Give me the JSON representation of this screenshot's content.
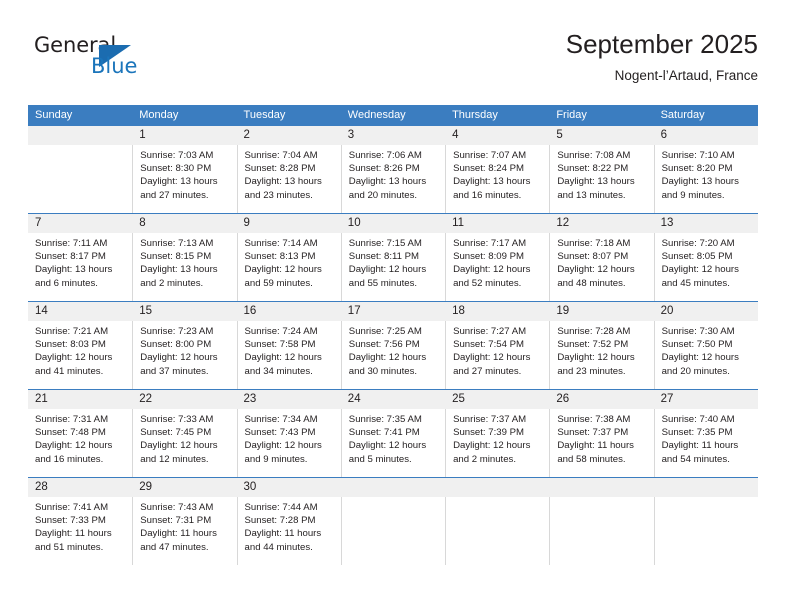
{
  "brand": {
    "name_part1": "General",
    "name_part2": "Blue",
    "accent_color": "#1b75bb"
  },
  "header": {
    "title": "September 2025",
    "subtitle": "Nogent-l’Artaud, France"
  },
  "calendar": {
    "header_color": "#3b7dc0",
    "day_band_color": "#f0f0f0",
    "weekday_headers": [
      "Sunday",
      "Monday",
      "Tuesday",
      "Wednesday",
      "Thursday",
      "Friday",
      "Saturday"
    ],
    "weeks": [
      {
        "days": [
          {
            "num": "",
            "sunrise": "",
            "sunset": "",
            "daylight1": "",
            "daylight2": ""
          },
          {
            "num": "1",
            "sunrise": "Sunrise: 7:03 AM",
            "sunset": "Sunset: 8:30 PM",
            "daylight1": "Daylight: 13 hours",
            "daylight2": "and 27 minutes."
          },
          {
            "num": "2",
            "sunrise": "Sunrise: 7:04 AM",
            "sunset": "Sunset: 8:28 PM",
            "daylight1": "Daylight: 13 hours",
            "daylight2": "and 23 minutes."
          },
          {
            "num": "3",
            "sunrise": "Sunrise: 7:06 AM",
            "sunset": "Sunset: 8:26 PM",
            "daylight1": "Daylight: 13 hours",
            "daylight2": "and 20 minutes."
          },
          {
            "num": "4",
            "sunrise": "Sunrise: 7:07 AM",
            "sunset": "Sunset: 8:24 PM",
            "daylight1": "Daylight: 13 hours",
            "daylight2": "and 16 minutes."
          },
          {
            "num": "5",
            "sunrise": "Sunrise: 7:08 AM",
            "sunset": "Sunset: 8:22 PM",
            "daylight1": "Daylight: 13 hours",
            "daylight2": "and 13 minutes."
          },
          {
            "num": "6",
            "sunrise": "Sunrise: 7:10 AM",
            "sunset": "Sunset: 8:20 PM",
            "daylight1": "Daylight: 13 hours",
            "daylight2": "and 9 minutes."
          }
        ]
      },
      {
        "days": [
          {
            "num": "7",
            "sunrise": "Sunrise: 7:11 AM",
            "sunset": "Sunset: 8:17 PM",
            "daylight1": "Daylight: 13 hours",
            "daylight2": "and 6 minutes."
          },
          {
            "num": "8",
            "sunrise": "Sunrise: 7:13 AM",
            "sunset": "Sunset: 8:15 PM",
            "daylight1": "Daylight: 13 hours",
            "daylight2": "and 2 minutes."
          },
          {
            "num": "9",
            "sunrise": "Sunrise: 7:14 AM",
            "sunset": "Sunset: 8:13 PM",
            "daylight1": "Daylight: 12 hours",
            "daylight2": "and 59 minutes."
          },
          {
            "num": "10",
            "sunrise": "Sunrise: 7:15 AM",
            "sunset": "Sunset: 8:11 PM",
            "daylight1": "Daylight: 12 hours",
            "daylight2": "and 55 minutes."
          },
          {
            "num": "11",
            "sunrise": "Sunrise: 7:17 AM",
            "sunset": "Sunset: 8:09 PM",
            "daylight1": "Daylight: 12 hours",
            "daylight2": "and 52 minutes."
          },
          {
            "num": "12",
            "sunrise": "Sunrise: 7:18 AM",
            "sunset": "Sunset: 8:07 PM",
            "daylight1": "Daylight: 12 hours",
            "daylight2": "and 48 minutes."
          },
          {
            "num": "13",
            "sunrise": "Sunrise: 7:20 AM",
            "sunset": "Sunset: 8:05 PM",
            "daylight1": "Daylight: 12 hours",
            "daylight2": "and 45 minutes."
          }
        ]
      },
      {
        "days": [
          {
            "num": "14",
            "sunrise": "Sunrise: 7:21 AM",
            "sunset": "Sunset: 8:03 PM",
            "daylight1": "Daylight: 12 hours",
            "daylight2": "and 41 minutes."
          },
          {
            "num": "15",
            "sunrise": "Sunrise: 7:23 AM",
            "sunset": "Sunset: 8:00 PM",
            "daylight1": "Daylight: 12 hours",
            "daylight2": "and 37 minutes."
          },
          {
            "num": "16",
            "sunrise": "Sunrise: 7:24 AM",
            "sunset": "Sunset: 7:58 PM",
            "daylight1": "Daylight: 12 hours",
            "daylight2": "and 34 minutes."
          },
          {
            "num": "17",
            "sunrise": "Sunrise: 7:25 AM",
            "sunset": "Sunset: 7:56 PM",
            "daylight1": "Daylight: 12 hours",
            "daylight2": "and 30 minutes."
          },
          {
            "num": "18",
            "sunrise": "Sunrise: 7:27 AM",
            "sunset": "Sunset: 7:54 PM",
            "daylight1": "Daylight: 12 hours",
            "daylight2": "and 27 minutes."
          },
          {
            "num": "19",
            "sunrise": "Sunrise: 7:28 AM",
            "sunset": "Sunset: 7:52 PM",
            "daylight1": "Daylight: 12 hours",
            "daylight2": "and 23 minutes."
          },
          {
            "num": "20",
            "sunrise": "Sunrise: 7:30 AM",
            "sunset": "Sunset: 7:50 PM",
            "daylight1": "Daylight: 12 hours",
            "daylight2": "and 20 minutes."
          }
        ]
      },
      {
        "days": [
          {
            "num": "21",
            "sunrise": "Sunrise: 7:31 AM",
            "sunset": "Sunset: 7:48 PM",
            "daylight1": "Daylight: 12 hours",
            "daylight2": "and 16 minutes."
          },
          {
            "num": "22",
            "sunrise": "Sunrise: 7:33 AM",
            "sunset": "Sunset: 7:45 PM",
            "daylight1": "Daylight: 12 hours",
            "daylight2": "and 12 minutes."
          },
          {
            "num": "23",
            "sunrise": "Sunrise: 7:34 AM",
            "sunset": "Sunset: 7:43 PM",
            "daylight1": "Daylight: 12 hours",
            "daylight2": "and 9 minutes."
          },
          {
            "num": "24",
            "sunrise": "Sunrise: 7:35 AM",
            "sunset": "Sunset: 7:41 PM",
            "daylight1": "Daylight: 12 hours",
            "daylight2": "and 5 minutes."
          },
          {
            "num": "25",
            "sunrise": "Sunrise: 7:37 AM",
            "sunset": "Sunset: 7:39 PM",
            "daylight1": "Daylight: 12 hours",
            "daylight2": "and 2 minutes."
          },
          {
            "num": "26",
            "sunrise": "Sunrise: 7:38 AM",
            "sunset": "Sunset: 7:37 PM",
            "daylight1": "Daylight: 11 hours",
            "daylight2": "and 58 minutes."
          },
          {
            "num": "27",
            "sunrise": "Sunrise: 7:40 AM",
            "sunset": "Sunset: 7:35 PM",
            "daylight1": "Daylight: 11 hours",
            "daylight2": "and 54 minutes."
          }
        ]
      },
      {
        "days": [
          {
            "num": "28",
            "sunrise": "Sunrise: 7:41 AM",
            "sunset": "Sunset: 7:33 PM",
            "daylight1": "Daylight: 11 hours",
            "daylight2": "and 51 minutes."
          },
          {
            "num": "29",
            "sunrise": "Sunrise: 7:43 AM",
            "sunset": "Sunset: 7:31 PM",
            "daylight1": "Daylight: 11 hours",
            "daylight2": "and 47 minutes."
          },
          {
            "num": "30",
            "sunrise": "Sunrise: 7:44 AM",
            "sunset": "Sunset: 7:28 PM",
            "daylight1": "Daylight: 11 hours",
            "daylight2": "and 44 minutes."
          },
          {
            "num": "",
            "sunrise": "",
            "sunset": "",
            "daylight1": "",
            "daylight2": ""
          },
          {
            "num": "",
            "sunrise": "",
            "sunset": "",
            "daylight1": "",
            "daylight2": ""
          },
          {
            "num": "",
            "sunrise": "",
            "sunset": "",
            "daylight1": "",
            "daylight2": ""
          },
          {
            "num": "",
            "sunrise": "",
            "sunset": "",
            "daylight1": "",
            "daylight2": ""
          }
        ]
      }
    ]
  }
}
